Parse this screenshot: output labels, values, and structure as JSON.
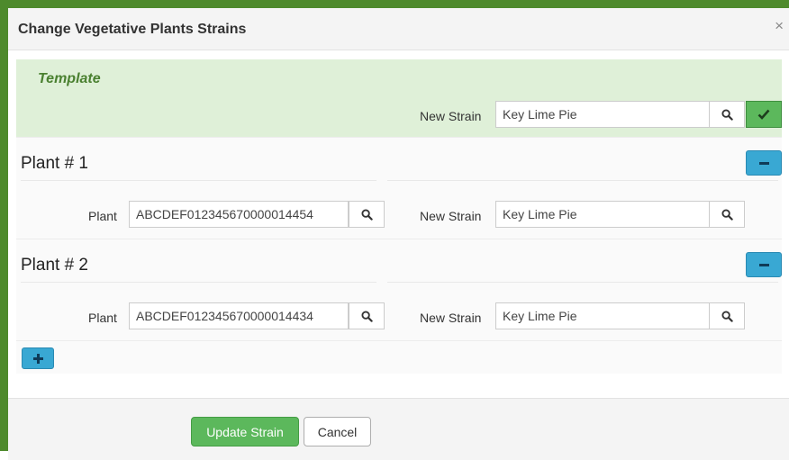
{
  "dialog": {
    "title": "Change Vegetative Plants Strains",
    "close_label": "×"
  },
  "template": {
    "label": "Template",
    "new_strain_label": "New Strain",
    "new_strain_value": "Key Lime Pie"
  },
  "plants": [
    {
      "title": "Plant # 1",
      "plant_label": "Plant",
      "plant_value": "ABCDEF012345670000014454",
      "new_strain_label": "New Strain",
      "new_strain_value": "Key Lime Pie"
    },
    {
      "title": "Plant # 2",
      "plant_label": "Plant",
      "plant_value": "ABCDEF012345670000014434",
      "new_strain_label": "New Strain",
      "new_strain_value": "Key Lime Pie"
    }
  ],
  "footer": {
    "update_label": "Update Strain",
    "cancel_label": "Cancel"
  },
  "colors": {
    "frame": "#4e8a2c",
    "template_bg": "#dff0d8",
    "success": "#5cb85c",
    "info": "#39a8d3"
  },
  "icons": {
    "search": "search-icon",
    "confirm": "check-icon",
    "remove": "minus-icon",
    "add": "plus-icon",
    "close": "close-icon"
  }
}
